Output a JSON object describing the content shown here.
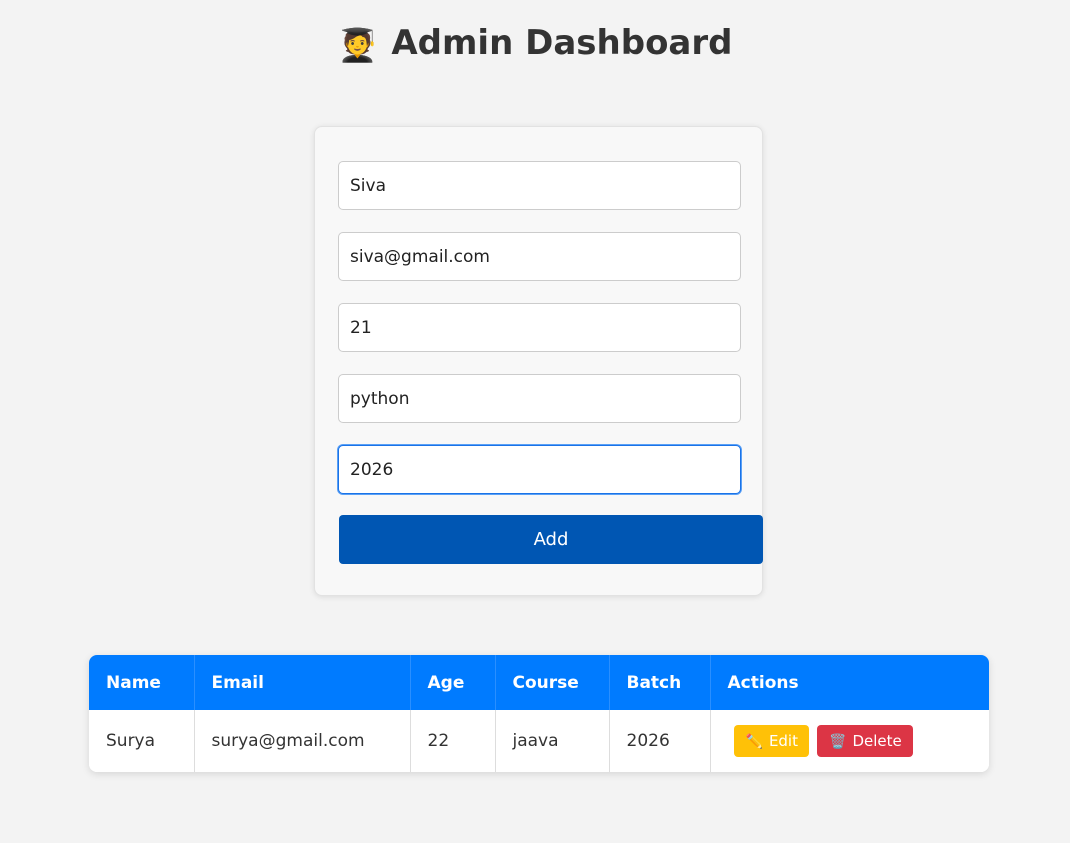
{
  "header": {
    "icon": "🧑‍🎓",
    "title": "Admin Dashboard"
  },
  "form": {
    "fields": [
      {
        "value": "Siva"
      },
      {
        "value": "siva@gmail.com"
      },
      {
        "value": "21"
      },
      {
        "value": "python"
      },
      {
        "value": "2026"
      }
    ],
    "add_label": "Add"
  },
  "table": {
    "headers": [
      "Name",
      "Email",
      "Age",
      "Course",
      "Batch",
      "Actions"
    ],
    "rows": [
      {
        "name": "Surya",
        "email": "surya@gmail.com",
        "age": "22",
        "course": "jaava",
        "batch": "2026",
        "edit_icon": "✏️",
        "edit_label": "Edit",
        "delete_icon": "🗑️",
        "delete_label": "Delete"
      }
    ]
  },
  "colors": {
    "background": "#f3f3f3",
    "header_blue": "#007bff",
    "add_button": "#0056b3",
    "edit_button": "#ffc107",
    "delete_button": "#dc3545"
  }
}
